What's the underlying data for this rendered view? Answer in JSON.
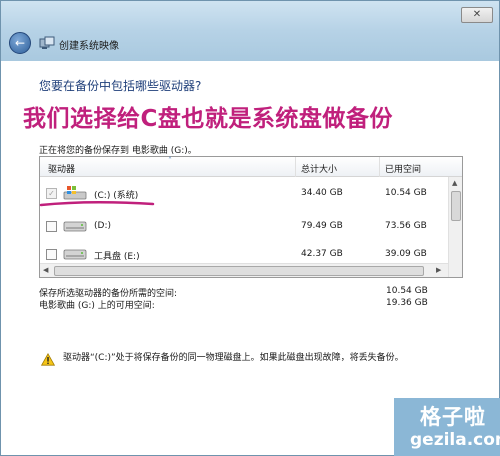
{
  "window": {
    "title": "创建系统映像",
    "close_glyph": "✕"
  },
  "heading": "您要在备份中包括哪些驱动器?",
  "annotation": "我们选择给C盘也就是系统盘做备份",
  "save_location": "正在将您的备份保存到 电影歌曲 (G:)。",
  "table": {
    "columns": [
      "驱动器",
      "总计大小",
      "已用空间"
    ],
    "rows": [
      {
        "name": "(C:) (系统)",
        "total": "34.40 GB",
        "used": "10.54 GB",
        "checked": true,
        "disabled": true,
        "icon": "windows-drive-icon"
      },
      {
        "name": "(D:)",
        "total": "79.49 GB",
        "used": "73.56 GB",
        "checked": false,
        "disabled": false,
        "icon": "hard-drive-icon"
      },
      {
        "name": "工具盘 (E:)",
        "total": "42.37 GB",
        "used": "39.09 GB",
        "checked": false,
        "disabled": false,
        "icon": "hard-drive-icon"
      }
    ]
  },
  "summary": {
    "required_label": "保存所选驱动器的备份所需的空间:",
    "required_value": "10.54 GB",
    "available_label": "电影歌曲 (G:) 上的可用空间:",
    "available_value": "19.36 GB"
  },
  "warning": "驱动器“(C:)”处于将保存备份的同一物理磁盘上。如果此磁盘出现故障，将丢失备份。",
  "watermark": {
    "cn": "格子啦",
    "en": "gezila.com"
  },
  "colors": {
    "annotation": "#c0207c",
    "underline": "#c0207c",
    "titlebar": "#b6d2e6"
  }
}
